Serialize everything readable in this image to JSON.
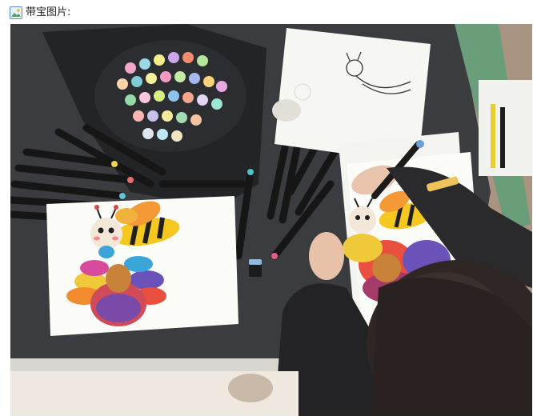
{
  "header": {
    "icon": "image-icon",
    "label": "带宝图片:"
  },
  "image": {
    "alt": "",
    "colors": {
      "table": "#3b3c3f",
      "floor": "#a99482",
      "paper": "#fbfbf8",
      "bee_yellow": "#f4c81f",
      "bee_black": "#1f1f1f",
      "wing_orange": "#f39a37"
    }
  }
}
